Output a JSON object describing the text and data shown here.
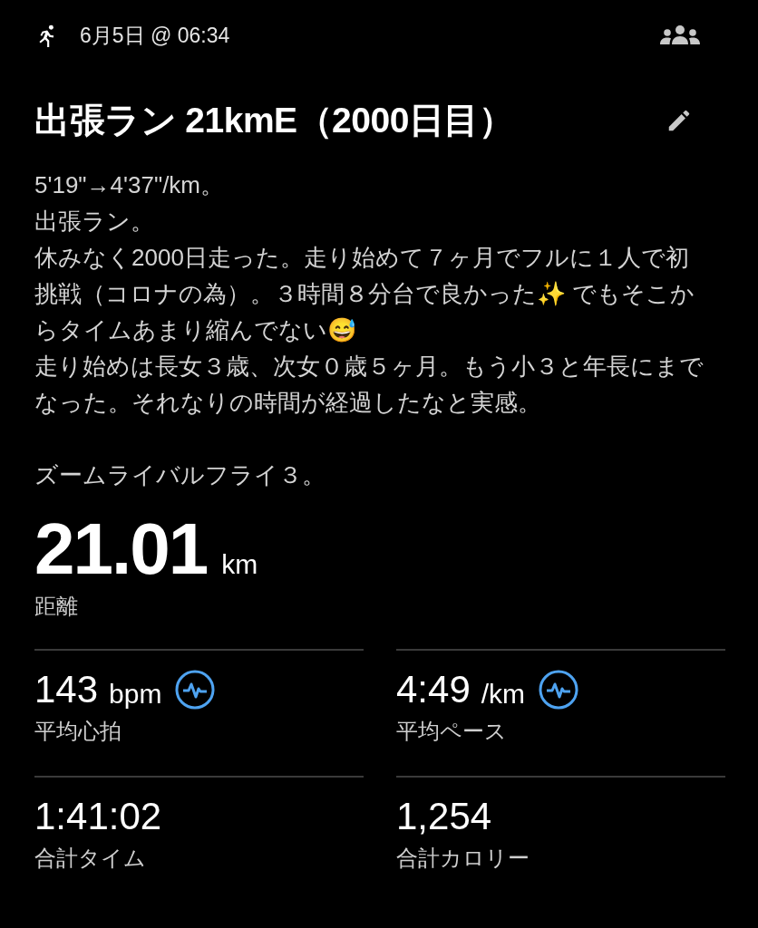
{
  "header": {
    "datetime": "6月5日 @ 06:34"
  },
  "title": "出張ラン 21kmE（2000日目）",
  "description": [
    [
      "5'19\"→4'37\"/km。",
      "出張ラン。",
      "休みなく2000日走った。走り始めて７ヶ月でフルに１人で初挑戦（コロナの為）。３時間８分台で良かった✨ でもそこからタイムあまり縮んでない😅",
      "走り始めは長女３歳、次女０歳５ヶ月。もう小３と年長にまでなった。それなりの時間が経過したなと実感。"
    ],
    [
      "ズームライバルフライ３。"
    ]
  ],
  "distance": {
    "value": "21.01",
    "unit": "km",
    "label": "距離"
  },
  "stats": [
    {
      "value": "143",
      "unit": "bpm",
      "label": "平均心拍",
      "chart_link": true
    },
    {
      "value": "4:49",
      "unit": "/km",
      "label": "平均ペース",
      "chart_link": true
    },
    {
      "value": "1:41:02",
      "label": "合計タイム",
      "chart_link": false
    },
    {
      "value": "1,254",
      "label": "合計カロリー",
      "chart_link": false
    }
  ]
}
